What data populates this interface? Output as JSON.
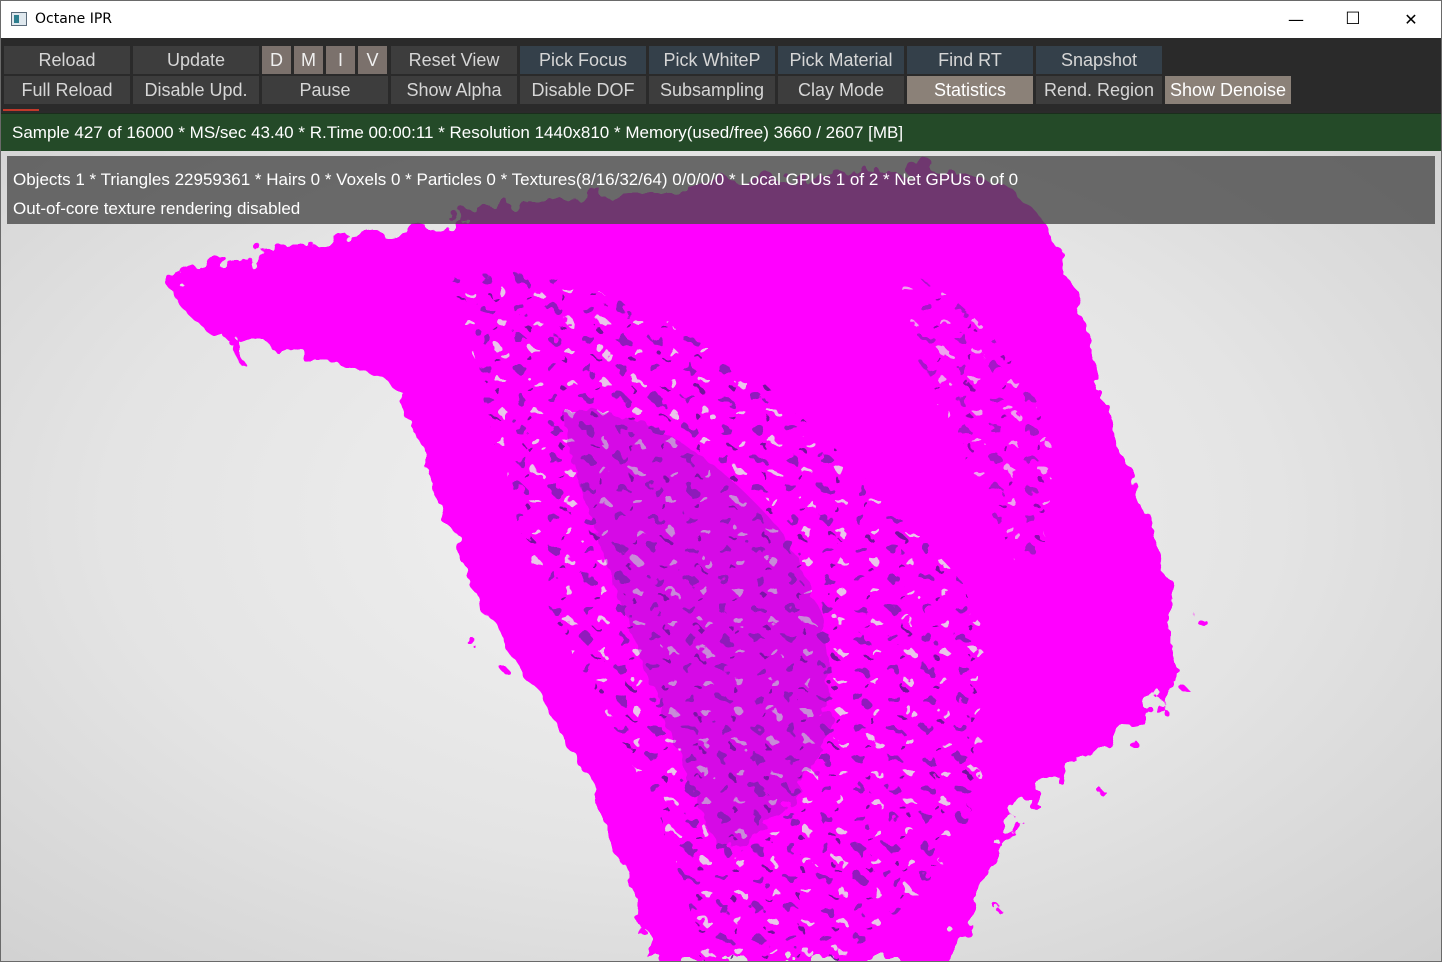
{
  "window": {
    "title": "Octane IPR",
    "minimize_glyph": "—",
    "maximize_glyph": "☐",
    "close_glyph": "✕"
  },
  "toolbar": {
    "row1": {
      "reload": "Reload",
      "update": "Update",
      "d": "D",
      "m": "M",
      "i": "I",
      "v": "V",
      "reset_view": "Reset View",
      "pick_focus": "Pick Focus",
      "pick_whitep": "Pick WhiteP",
      "pick_material": "Pick Material",
      "find_rt": "Find RT",
      "snapshot": "Snapshot"
    },
    "row2": {
      "full_reload": "Full Reload",
      "disable_upd": "Disable Upd.",
      "pause": "Pause",
      "show_alpha": "Show Alpha",
      "disable_dof": "Disable DOF",
      "subsampling": "Subsampling",
      "clay_mode": "Clay Mode",
      "statistics": "Statistics",
      "rend_region": "Rend. Region",
      "show_denoise": "Show Denoise"
    }
  },
  "status": {
    "line": "Sample 427 of 16000 * MS/sec 43.40 * R.Time 00:00:11 * Resolution 1440x810 * Memory(used/free) 3660 / 2607 [MB]"
  },
  "overlay": {
    "line1": "Objects 1 * Triangles 22959361 * Hairs 0 * Voxels 0 * Particles 0 * Textures(8/16/32/64) 0/0/0/0 * Local GPUs 1 of 2 * Net GPUs 0 of 0",
    "line2": "Out-of-core texture rendering disabled"
  },
  "colors": {
    "fluid": "#ff00ff",
    "fluid_shadow": "#8a1fb8",
    "status_bg": "#244a28"
  }
}
